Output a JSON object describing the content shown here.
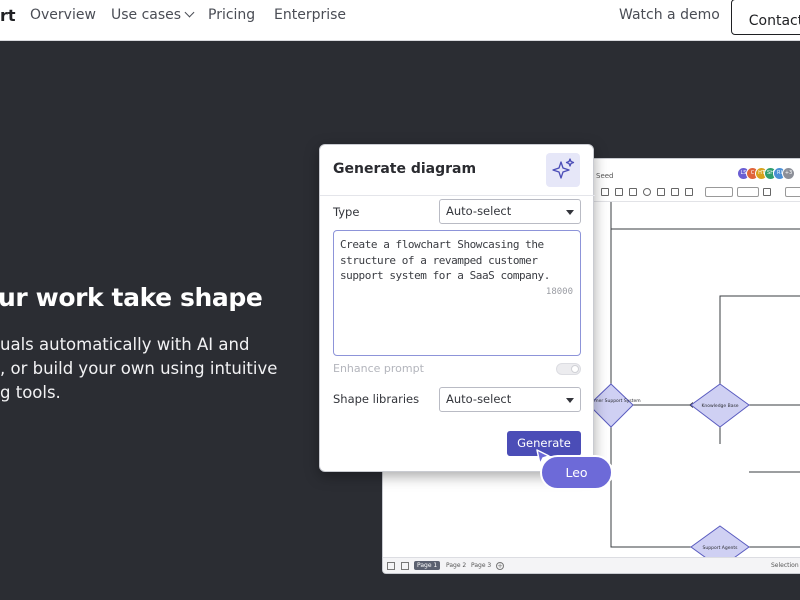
{
  "nav": {
    "logo_fragment": "rt",
    "links": [
      "Overview",
      "Use cases",
      "Pricing",
      "Enterprise"
    ],
    "watch_demo": "Watch a demo",
    "contact": "Contact"
  },
  "hero": {
    "heading": "ur work take shape",
    "lines": [
      "uals automatically with AI and",
      ", or build your own using intuitive",
      "g tools."
    ]
  },
  "dialog": {
    "title": "Generate diagram",
    "type_label": "Type",
    "type_value": "Auto-select",
    "prompt": "Create a flowchart Showcasing the structure of a revamped customer support system for a SaaS company.",
    "char_count": "18000",
    "enhance_label": "Enhance prompt",
    "enhance_enabled": false,
    "shape_label": "Shape libraries",
    "shape_value": "Auto-select",
    "generate": "Generate",
    "accent_color": "#4b4db7"
  },
  "editor": {
    "title_fragment": "Seed",
    "collaborators": [
      "LS",
      "C",
      "HT",
      "SH",
      "RI",
      "+3"
    ],
    "collaborator_colors": [
      "#6b5fd3",
      "#e0643a",
      "#d8a21b",
      "#2f9e6e",
      "#4b8fd6",
      "#8c8f98"
    ],
    "nodes": [
      "Customer Support System",
      "Knowledge Base",
      "Support Agents"
    ],
    "pages": [
      "Page 1",
      "Page 2",
      "Page 3"
    ],
    "selection_label": "Selection"
  },
  "cursor": {
    "name": "Leo",
    "color": "#6d6ad8"
  }
}
